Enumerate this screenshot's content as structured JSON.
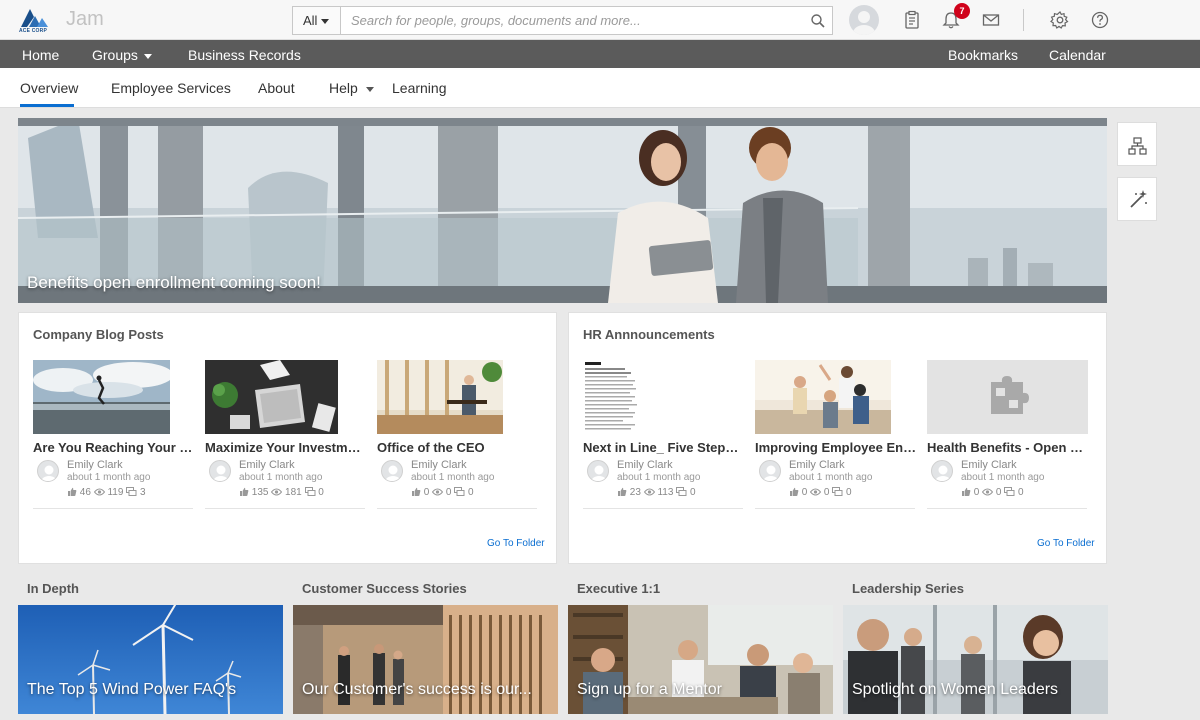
{
  "header": {
    "logo_text": "ACE CORP",
    "app_title": "Jam",
    "search_scope": "All",
    "search_placeholder": "Search for people, groups, documents and more...",
    "notification_count": "7",
    "icons": [
      "user-avatar",
      "clipboard-icon",
      "bell-icon",
      "mail-icon",
      "gear-icon",
      "help-icon"
    ]
  },
  "nav": {
    "left": [
      "Home",
      "Groups",
      "Business Records"
    ],
    "right": [
      "Bookmarks",
      "Calendar"
    ]
  },
  "subnav": {
    "items": [
      "Overview",
      "Employee Services",
      "About",
      "Help",
      "Learning"
    ],
    "active": "Overview"
  },
  "hero": {
    "caption": "Benefits open enrollment coming soon!"
  },
  "side_buttons": [
    "org-chart-icon",
    "magic-wand-icon"
  ],
  "blog": {
    "title": "Company Blog Posts",
    "go_folder": "Go To Folder",
    "items": [
      {
        "title": "Are You Reaching Your F...",
        "author": "Emily Clark",
        "when": "about 1 month ago",
        "likes": "46",
        "views": "119",
        "comments": "3"
      },
      {
        "title": "Maximize Your Investments",
        "author": "Emily Clark",
        "when": "about 1 month ago",
        "likes": "135",
        "views": "181",
        "comments": "0"
      },
      {
        "title": "Office of the CEO",
        "author": "Emily Clark",
        "when": "about 1 month ago",
        "likes": "0",
        "views": "0",
        "comments": "0"
      }
    ]
  },
  "hr": {
    "title": "HR Annnouncements",
    "go_folder": "Go To Folder",
    "items": [
      {
        "title": "Next in Line_ Five Steps ...",
        "author": "Emily Clark",
        "when": "about 1 month ago",
        "likes": "23",
        "views": "113",
        "comments": "0"
      },
      {
        "title": "Improving Employee Eng...",
        "author": "Emily Clark",
        "when": "about 1 month ago",
        "likes": "0",
        "views": "0",
        "comments": "0"
      },
      {
        "title": "Health Benefits - Open E...",
        "author": "Emily Clark",
        "when": "about 1 month ago",
        "likes": "0",
        "views": "0",
        "comments": "0"
      }
    ]
  },
  "tiles": [
    {
      "title": "In Depth",
      "caption": "The Top 5 Wind Power FAQ's"
    },
    {
      "title": "Customer Success Stories",
      "caption": "Our Customer's success is our..."
    },
    {
      "title": "Executive 1:1",
      "caption": "Sign up for a Mentor"
    },
    {
      "title": "Leadership Series",
      "caption": "Spotlight on Women Leaders"
    }
  ],
  "colors": {
    "accent": "#0a6ed1",
    "nav_bg": "#5b5b5b",
    "badge": "#d0021b"
  }
}
